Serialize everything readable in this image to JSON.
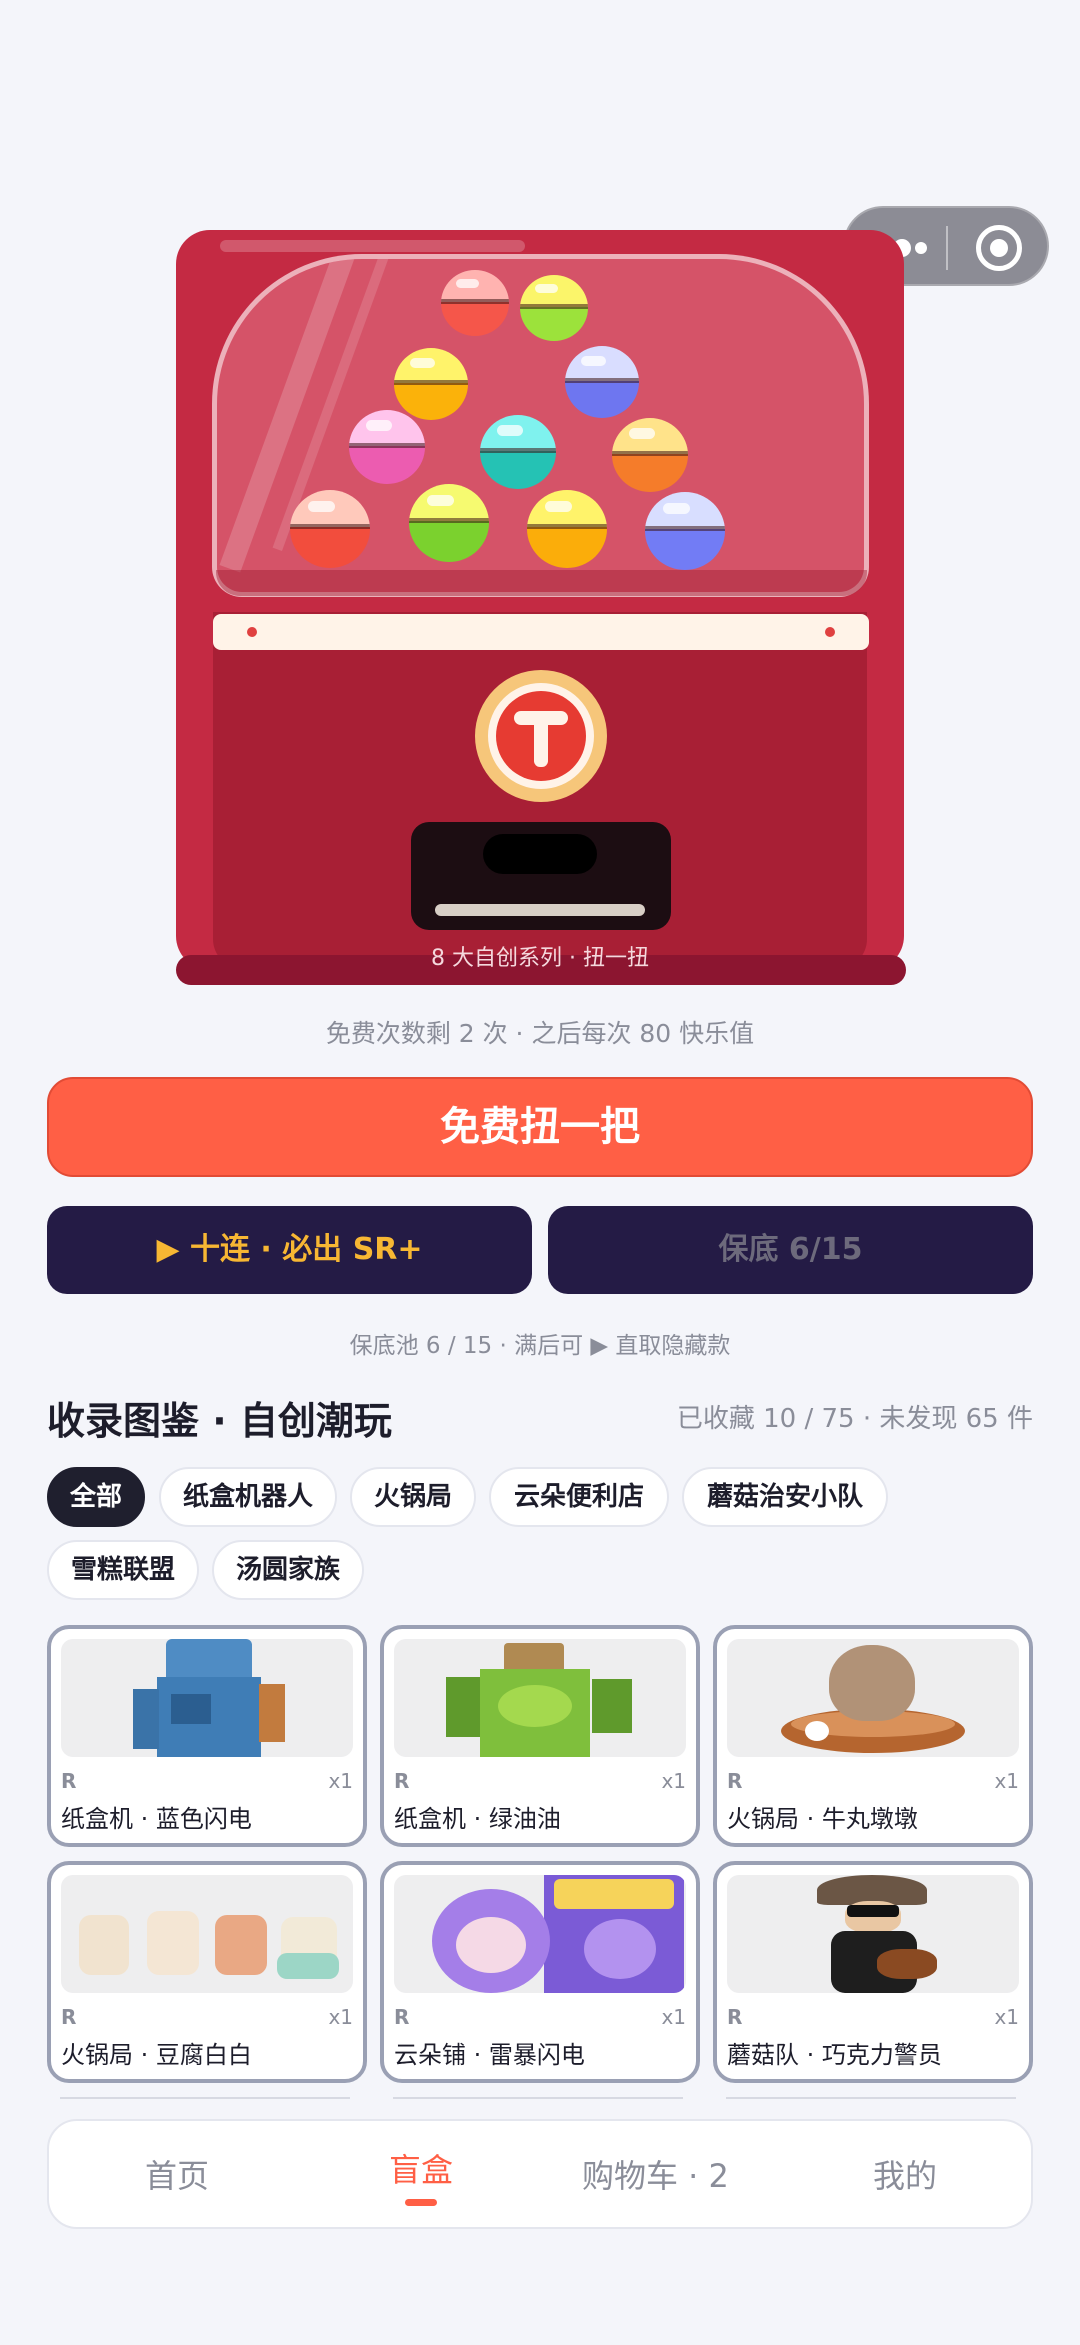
{
  "machine": {
    "label": "8 大自创系列 · 扭一扭"
  },
  "gacha": {
    "free_note": "免费次数剩 2 次 · 之后每次 80 快乐值",
    "main_button": "免费扭一把",
    "ten_button": "▶ 十连 · 必出 SR+",
    "guarantee_button": "保底 6/15",
    "guarantee_note": "保底池 6 / 15 · 满后可 ▶ 直取隐藏款"
  },
  "collection": {
    "title": "收录图鉴 · 自创潮玩",
    "stats": "已收藏 10 / 75 · 未发现 65 件"
  },
  "filters": [
    "全部",
    "纸盒机器人",
    "火锅局",
    "云朵便利店",
    "蘑菇治安小队",
    "雪糕联盟",
    "汤圆家族"
  ],
  "cards": [
    {
      "rarity": "R",
      "qty": "x1",
      "name": "纸盒机 · 蓝色闪电",
      "icon": "blue-box-robot"
    },
    {
      "rarity": "R",
      "qty": "x1",
      "name": "纸盒机 · 绿油油",
      "icon": "green-carton-robot"
    },
    {
      "rarity": "R",
      "qty": "x1",
      "name": "火锅局 · 牛丸墩墩",
      "icon": "meatball-hotpot"
    },
    {
      "rarity": "R",
      "qty": "x1",
      "name": "火锅局 · 豆腐白白",
      "icon": "tofu-figures"
    },
    {
      "rarity": "R",
      "qty": "x1",
      "name": "云朵铺 · 雷暴闪电",
      "icon": "purple-cloud-sprite"
    },
    {
      "rarity": "R",
      "qty": "x1",
      "name": "蘑菇队 · 巧克力警员",
      "icon": "mushroom-guitarist"
    }
  ],
  "tabbar": {
    "home": "首页",
    "blindbox": "盲盒",
    "cart": "购物车 · 2",
    "mine": "我的"
  },
  "colors": {
    "accent": "#ff5f45",
    "navy": "#241b45",
    "gold": "#f7b733",
    "machine_red": "#c42a43"
  }
}
